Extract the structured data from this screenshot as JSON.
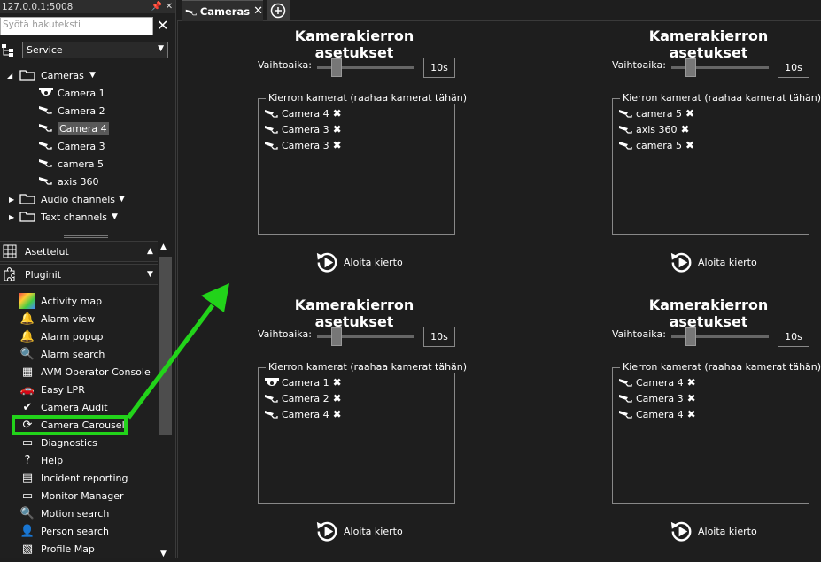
{
  "window": {
    "address": "127.0.0.1:5008"
  },
  "search": {
    "placeholder": "Syötä hakuteksti"
  },
  "server_select": {
    "value": "Service"
  },
  "tree": {
    "cameras_label": "Cameras",
    "cameras": [
      "Camera 1",
      "Camera 2",
      "Camera 4",
      "Camera 3",
      "camera 5",
      "axis 360"
    ],
    "selected_camera": "Camera 4",
    "audio_label": "Audio channels",
    "text_label": "Text channels"
  },
  "sections": {
    "layouts": "Asettelut",
    "plugins": "Pluginit"
  },
  "plugins": [
    "Activity map",
    "Alarm view",
    "Alarm popup",
    "Alarm search",
    "AVM Operator Console",
    "Easy LPR",
    "Camera Audit",
    "Camera Carousel",
    "Diagnostics",
    "Help",
    "Incident reporting",
    "Monitor Manager",
    "Motion search",
    "Person search",
    "Profile Map"
  ],
  "highlighted_plugin": "Camera Carousel",
  "tabs": [
    {
      "label": "Cameras"
    }
  ],
  "panels": [
    {
      "title": "Kamerakierron asetukset",
      "interval_label": "Vaihtoaika:",
      "interval_value": "10s",
      "interval_level": 0.2,
      "group_label": "Kierron kamerat (raahaa kamerat tähän)",
      "cameras": [
        "Camera 4",
        "Camera 3",
        "Camera 3"
      ],
      "start_label": "Aloita kierto"
    },
    {
      "title": "Kamerakierron asetukset",
      "interval_label": "Vaihtoaika:",
      "interval_value": "10s",
      "interval_level": 0.2,
      "group_label": "Kierron kamerat (raahaa kamerat tähän)",
      "cameras": [
        "camera 5",
        "axis 360",
        "camera 5"
      ],
      "start_label": "Aloita kierto"
    },
    {
      "title": "Kamerakierron asetukset",
      "interval_label": "Vaihtoaika:",
      "interval_value": "10s",
      "interval_level": 0.2,
      "group_label": "Kierron kamerat (raahaa kamerat tähän)",
      "cameras": [
        "Camera 1",
        "Camera 2",
        "Camera 4"
      ],
      "start_label": "Aloita kierto"
    },
    {
      "title": "Kamerakierron asetukset",
      "interval_label": "Vaihtoaika:",
      "interval_value": "10s",
      "interval_level": 0.2,
      "group_label": "Kierron kamerat (raahaa kamerat tähän)",
      "cameras": [
        "Camera 4",
        "Camera 3",
        "Camera 4"
      ],
      "start_label": "Aloita kierto"
    }
  ],
  "colors": {
    "highlight": "#22d31a",
    "background": "#1e1e1e"
  }
}
